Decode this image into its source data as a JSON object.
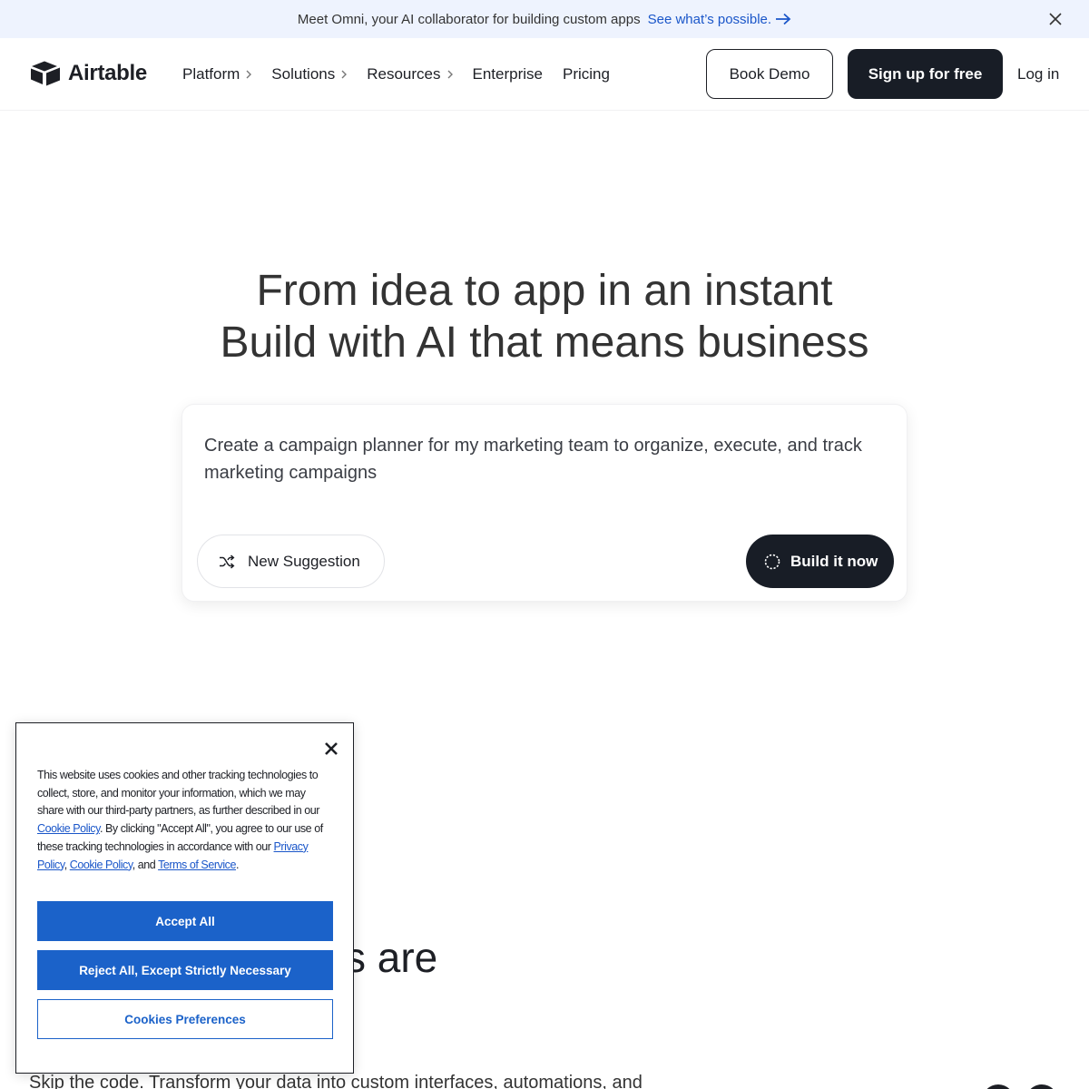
{
  "announcement": {
    "text": "Meet Omni, your AI collaborator for building custom apps",
    "link": "See what’s possible."
  },
  "nav": {
    "logo": "Airtable",
    "menu": [
      {
        "label": "Platform",
        "has_chevron": true
      },
      {
        "label": "Solutions",
        "has_chevron": true
      },
      {
        "label": "Resources",
        "has_chevron": true
      },
      {
        "label": "Enterprise",
        "has_chevron": false
      },
      {
        "label": "Pricing",
        "has_chevron": false
      }
    ],
    "book_demo": "Book Demo",
    "sign_up": "Sign up for free",
    "log_in": "Log in"
  },
  "hero": {
    "title_line1": "From idea to app in an instant",
    "title_line2": "Build with AI that means business",
    "prompt": "Create a campaign planner for my marketing team to organize, execute, and track marketing campaigns",
    "suggest_button": "New Suggestion",
    "build_button": "Build it now"
  },
  "below": {
    "heading_fragment": "s are",
    "text_fragment": "Skip the code. Transform your data into custom interfaces, automations, and"
  },
  "cookie": {
    "text_part1": "This website uses cookies and other tracking technologies to collect, store, and monitor your information, which we may share with our third-party partners, as further described in our ",
    "cookie_policy_link": "Cookie Policy",
    "text_part2": ". By clicking \"Accept All\", you agree to our use of these tracking technologies in accordance with our ",
    "privacy_policy_link": "Privacy Policy",
    "comma": ", ",
    "cookie_policy_link2": "Cookie Policy",
    "text_part3": ", and ",
    "terms_link": "Terms of Service",
    "period": ".",
    "accept_all": "Accept All",
    "reject_all": "Reject All, Except Strictly Necessary",
    "preferences": "Cookies Preferences"
  },
  "colors": {
    "dark": "#181d26",
    "link_blue": "#1a56c9",
    "cookie_blue": "#1b62c9",
    "announce_bg": "#eef3fe"
  }
}
